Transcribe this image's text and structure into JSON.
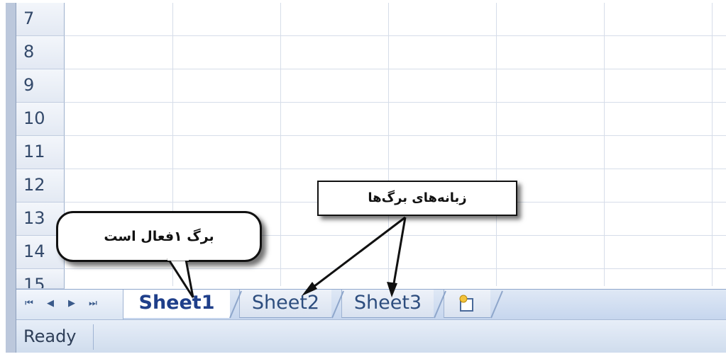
{
  "rows": [
    "7",
    "8",
    "9",
    "10",
    "11",
    "12",
    "13",
    "14",
    "15"
  ],
  "sheet_tabs": [
    {
      "label": "Sheet1",
      "active": true
    },
    {
      "label": "Sheet2",
      "active": false
    },
    {
      "label": "Sheet3",
      "active": false
    }
  ],
  "insert_sheet": {
    "icon": "insert-worksheet-icon"
  },
  "nav_buttons": {
    "first": {
      "glyph": "⏮",
      "icon": "first-sheet-icon"
    },
    "prev": {
      "glyph": "◀",
      "icon": "prev-sheet-icon"
    },
    "next": {
      "glyph": "▶",
      "icon": "next-sheet-icon"
    },
    "last": {
      "glyph": "⏭",
      "icon": "last-sheet-icon"
    }
  },
  "status": {
    "text": "Ready"
  },
  "annotations": {
    "callout_text": "برگ ۱فعال است",
    "tabs_label": "زبانه‌های برگ‌ها"
  },
  "colors": {
    "accent": "#1f3f8a",
    "grid_line": "#d6dde9",
    "tab_bar": "#c6d6ee"
  }
}
